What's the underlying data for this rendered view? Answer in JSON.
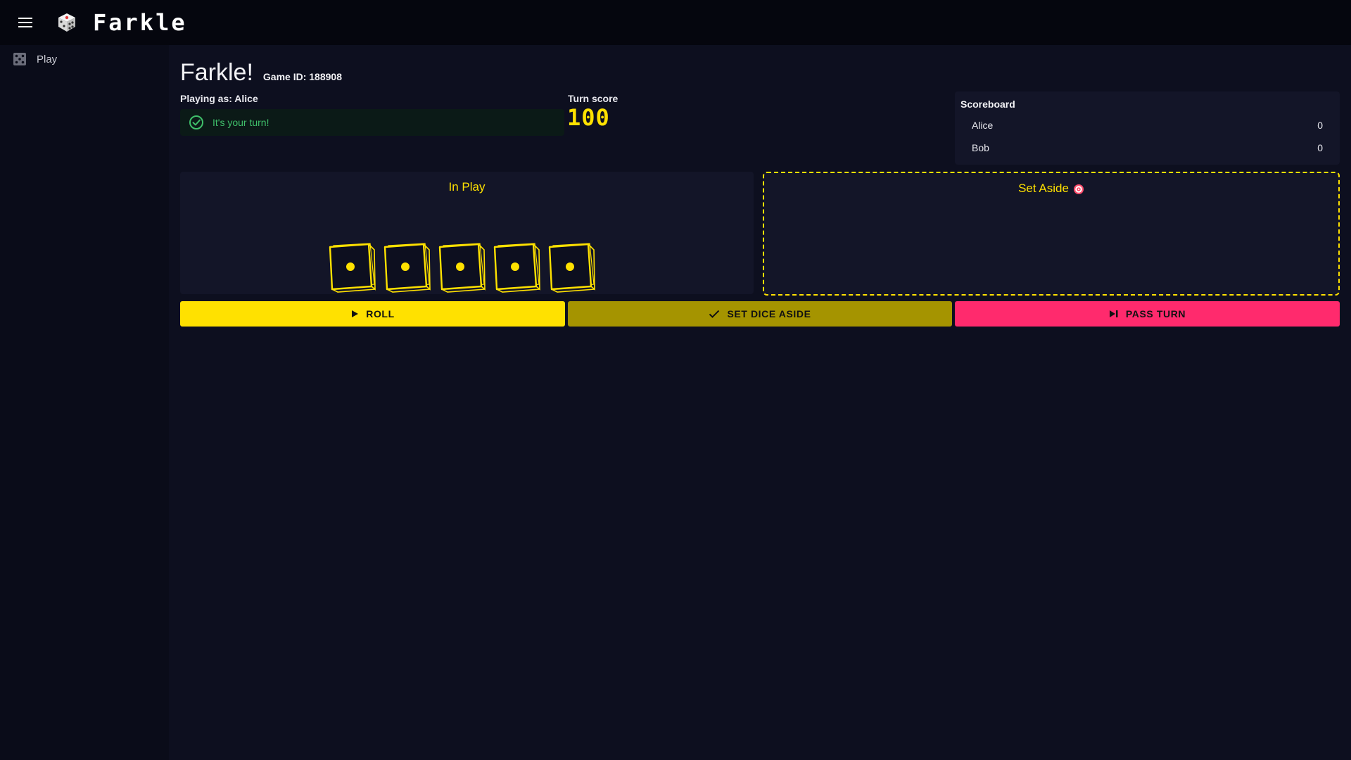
{
  "app": {
    "title": "Farkle"
  },
  "sidebar": {
    "items": [
      {
        "label": "Play",
        "icon": "dice-grid-icon"
      }
    ]
  },
  "game": {
    "title": "Farkle!",
    "game_id": "Game ID: 188908",
    "playing_as_label": "Playing as:",
    "player_name": "Alice",
    "turn_message": "It's your turn!",
    "turn_score_label": "Turn score",
    "turn_score": "100"
  },
  "scoreboard": {
    "title": "Scoreboard",
    "players": [
      {
        "name": "Alice",
        "score": "0"
      },
      {
        "name": "Bob",
        "score": "0"
      }
    ]
  },
  "in_play": {
    "title": "In Play",
    "dice": [
      1,
      1,
      1,
      1,
      1
    ]
  },
  "set_aside": {
    "title": "Set Aside",
    "dice": []
  },
  "actions": {
    "roll": "ROLL",
    "set_dice_aside": "SET DICE ASIDE",
    "pass_turn": "PASS TURN"
  },
  "colors": {
    "accent": "#ffe100",
    "set_aside_button": "#a59400",
    "pass_button": "#ff2a6d",
    "success": "#3fbf6a",
    "background": "#0d0f1f",
    "panel": "#131528"
  }
}
